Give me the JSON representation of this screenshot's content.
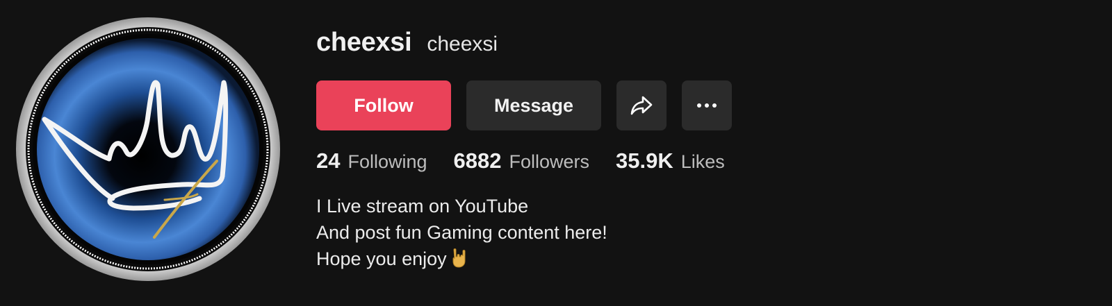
{
  "profile": {
    "display_name": "cheexsi",
    "handle": "cheexsi",
    "avatar": "crown-logo-avatar"
  },
  "actions": {
    "follow_label": "Follow",
    "message_label": "Message",
    "share_icon": "share-arrow-icon",
    "more_icon": "more-dots-icon"
  },
  "stats": [
    {
      "value": "24",
      "label": "Following"
    },
    {
      "value": "6882",
      "label": "Followers"
    },
    {
      "value": "35.9K",
      "label": "Likes"
    }
  ],
  "bio": {
    "line1": "I Live stream on YouTube",
    "line2": "And post fun Gaming content here!",
    "line3": "Hope you enjoy",
    "emoji": "rock-on-hand-emoji"
  },
  "colors": {
    "background": "#121212",
    "follow_button": "#ea4259",
    "secondary_button": "#2b2b2b"
  }
}
